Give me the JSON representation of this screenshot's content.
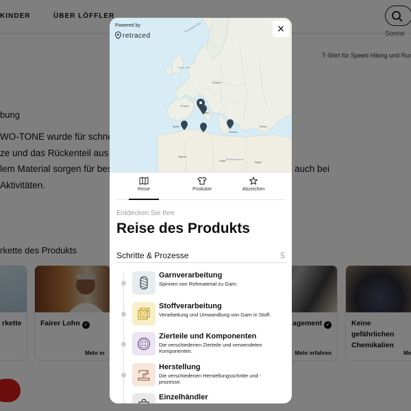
{
  "background": {
    "nav": [
      "KINDER",
      "ÜBER LÖFFLER"
    ],
    "right_top": "Sonne",
    "product_subtitle": "T-Shirt für Speed Hiking und Runn",
    "heading": "bung",
    "paragraph_lines": [
      {
        "left": "WO-TONE wurde für schnel",
        "right": ""
      },
      {
        "left": "ze und das Rückenteil aus ei",
        "right": ""
      },
      {
        "left": "lem Material sorgen für bes",
        "right": "auch bei"
      },
      {
        "left": "Aktivitäten.",
        "right": ""
      }
    ],
    "section_title": "rkette des Produkts",
    "cards": [
      {
        "title": "rkette",
        "more": ""
      },
      {
        "title": "Fairer Lohn",
        "more": "Mehr er"
      },
      {
        "title": "agement",
        "more": "Mehr erfahren"
      },
      {
        "title": "Keine gefährlichen Chemikalien",
        "more": "Meh"
      }
    ]
  },
  "modal": {
    "powered_by": "Powered by",
    "brand": "retraced",
    "close_label": "×",
    "tabs": [
      {
        "label": "Reise",
        "icon": "map-icon",
        "active": true
      },
      {
        "label": "Produkte",
        "icon": "tshirt-icon",
        "active": false
      },
      {
        "label": "Abzeichen",
        "icon": "star-icon",
        "active": false
      }
    ],
    "discover": "Entdecken Sie Ihre",
    "title": "Reise des Produkts",
    "steps_label": "Schritte & Prozesse",
    "steps_count": "5",
    "steps": [
      {
        "title": "Garnverarbeitung",
        "desc": "Spinnen von Rohmaterial zu Garn.",
        "icon": "yarn-icon",
        "color": "#e7ecef"
      },
      {
        "title": "Stoffverarbeitung",
        "desc": "Verarbeitung und Umwandlung von Garn in Stoff.",
        "icon": "fabric-icon",
        "color": "#f8efc8"
      },
      {
        "title": "Zierteile und Komponenten",
        "desc": "Die verschiedenen Zierteile und verwendeten Komponenten.",
        "icon": "button-icon",
        "color": "#ece3f3"
      },
      {
        "title": "Herstellung",
        "desc": "Die verschiedenen Herstellungsschritte und -prozesse.",
        "icon": "sewing-machine-icon",
        "color": "#f6e6dc"
      },
      {
        "title": "Einzelhändler",
        "desc": "",
        "icon": "shopping-bag-icon",
        "color": "#e9e9e9"
      }
    ],
    "map_labels": [
      "Norwegian Sea",
      "North Sea",
      "Poland",
      "France",
      "Spain",
      "Italy",
      "Greece",
      "Turkey",
      "Algeria",
      "Libya",
      "Egypt",
      "Mediterranean Sea"
    ],
    "map_pins": 4
  },
  "colors": {
    "overlay": "rgba(0,0,0,0.5)",
    "accent_red": "#d81b1b",
    "map_water": "#d7ecf4",
    "map_land": "#eef0e8",
    "pin": "#2f4756"
  }
}
